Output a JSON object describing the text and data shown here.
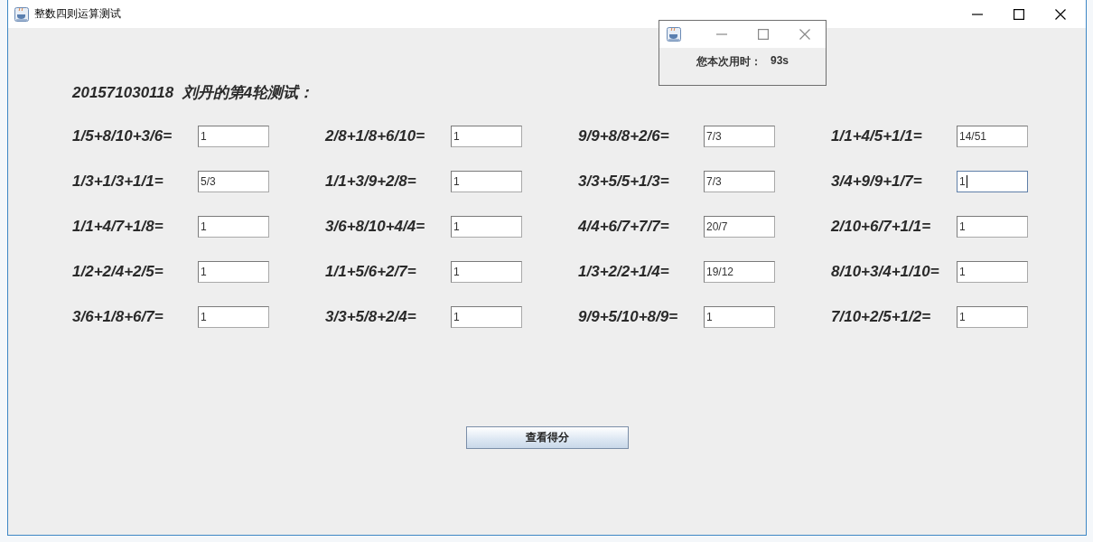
{
  "window": {
    "title": "整数四则运算测试"
  },
  "heading": "201571030118  刘丹的第4轮测试：",
  "questions": [
    {
      "expression": "1/5+8/10+3/6=",
      "answer": "1",
      "focused": false
    },
    {
      "expression": "2/8+1/8+6/10=",
      "answer": "1",
      "focused": false
    },
    {
      "expression": "9/9+8/8+2/6=",
      "answer": "7/3",
      "focused": false
    },
    {
      "expression": "1/1+4/5+1/1=",
      "answer": "14/51",
      "focused": false
    },
    {
      "expression": "1/3+1/3+1/1=",
      "answer": "5/3",
      "focused": false
    },
    {
      "expression": "1/1+3/9+2/8=",
      "answer": "1",
      "focused": false
    },
    {
      "expression": "3/3+5/5+1/3=",
      "answer": "7/3",
      "focused": false
    },
    {
      "expression": "3/4+9/9+1/7=",
      "answer": "1",
      "focused": true
    },
    {
      "expression": "1/1+4/7+1/8=",
      "answer": "1",
      "focused": false
    },
    {
      "expression": "3/6+8/10+4/4=",
      "answer": "1",
      "focused": false
    },
    {
      "expression": "4/4+6/7+7/7=",
      "answer": "20/7",
      "focused": false
    },
    {
      "expression": "2/10+6/7+1/1=",
      "answer": "1",
      "focused": false
    },
    {
      "expression": "1/2+2/4+2/5=",
      "answer": "1",
      "focused": false
    },
    {
      "expression": "1/1+5/6+2/7=",
      "answer": "1",
      "focused": false
    },
    {
      "expression": "1/3+2/2+1/4=",
      "answer": "19/12",
      "focused": false
    },
    {
      "expression": "8/10+3/4+1/10=",
      "answer": "1",
      "focused": false
    },
    {
      "expression": "3/6+1/8+6/7=",
      "answer": "1",
      "focused": false
    },
    {
      "expression": "3/3+5/8+2/4=",
      "answer": "1",
      "focused": false
    },
    {
      "expression": "9/9+5/10+8/9=",
      "answer": "1",
      "focused": false
    },
    {
      "expression": "7/10+2/5+1/2=",
      "answer": "1",
      "focused": false
    }
  ],
  "score_button": "查看得分",
  "timer_popup": {
    "label": "您本次用时：",
    "time": "93s"
  }
}
